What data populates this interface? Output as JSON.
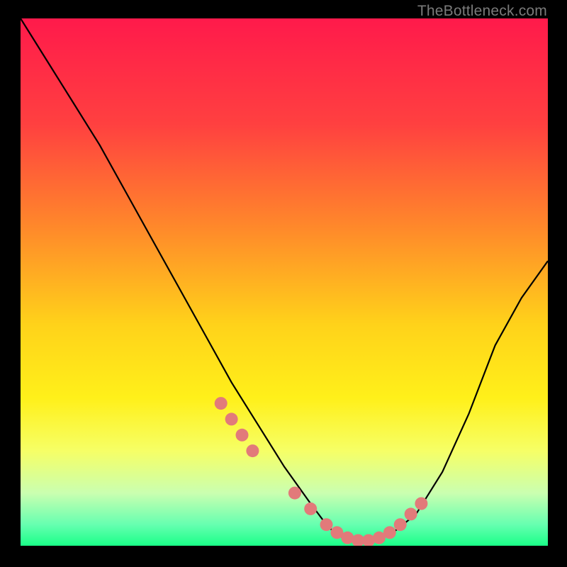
{
  "watermark": "TheBottleneck.com",
  "chart_data": {
    "type": "line",
    "title": "",
    "xlabel": "",
    "ylabel": "",
    "xlim": [
      0,
      100
    ],
    "ylim": [
      0,
      100
    ],
    "gradient_stops": [
      {
        "offset": 0,
        "color": "#ff1a4b"
      },
      {
        "offset": 20,
        "color": "#ff4040"
      },
      {
        "offset": 40,
        "color": "#ff8a2a"
      },
      {
        "offset": 58,
        "color": "#ffd21a"
      },
      {
        "offset": 72,
        "color": "#fff01a"
      },
      {
        "offset": 82,
        "color": "#f6ff66"
      },
      {
        "offset": 90,
        "color": "#caffb0"
      },
      {
        "offset": 96,
        "color": "#66ffb0"
      },
      {
        "offset": 100,
        "color": "#1aff88"
      }
    ],
    "curve": {
      "x": [
        0,
        5,
        10,
        15,
        20,
        25,
        30,
        35,
        40,
        45,
        50,
        55,
        58,
        60,
        63,
        66,
        70,
        75,
        80,
        85,
        90,
        95,
        100
      ],
      "y": [
        100,
        92,
        84,
        76,
        67,
        58,
        49,
        40,
        31,
        23,
        15,
        8,
        4,
        2,
        1,
        1,
        2,
        6,
        14,
        25,
        38,
        47,
        54
      ]
    },
    "markers": {
      "x": [
        38,
        40,
        42,
        44,
        52,
        55,
        58,
        60,
        62,
        64,
        66,
        68,
        70,
        72,
        74,
        76
      ],
      "y": [
        27,
        24,
        21,
        18,
        10,
        7,
        4,
        2.5,
        1.5,
        1,
        1,
        1.5,
        2.5,
        4,
        6,
        8
      ],
      "color": "#e27a7a",
      "radius": 9
    }
  }
}
